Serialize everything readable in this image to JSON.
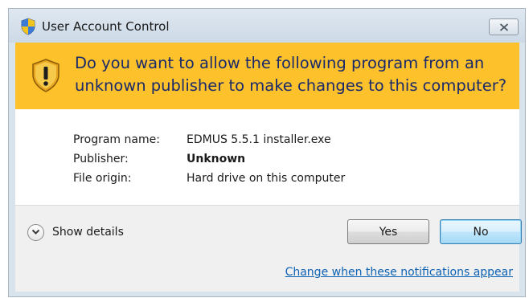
{
  "window": {
    "title": "User Account Control",
    "close_icon": "close-icon"
  },
  "banner": {
    "message": "Do you want to allow the following program from an unknown publisher to make changes to this computer?",
    "icon": "warning-shield-icon",
    "color": "#fdc12c",
    "text_color": "#1a2a6a"
  },
  "details": {
    "program_name_label": "Program name:",
    "program_name_value": "EDMUS 5.5.1 installer.exe",
    "publisher_label": "Publisher:",
    "publisher_value": "Unknown",
    "file_origin_label": "File origin:",
    "file_origin_value": "Hard drive on this computer"
  },
  "actions": {
    "show_details_label": "Show details",
    "yes_label": "Yes",
    "no_label": "No"
  },
  "footer": {
    "link_label": "Change when these notifications appear",
    "link_color": "#0d62b4"
  }
}
